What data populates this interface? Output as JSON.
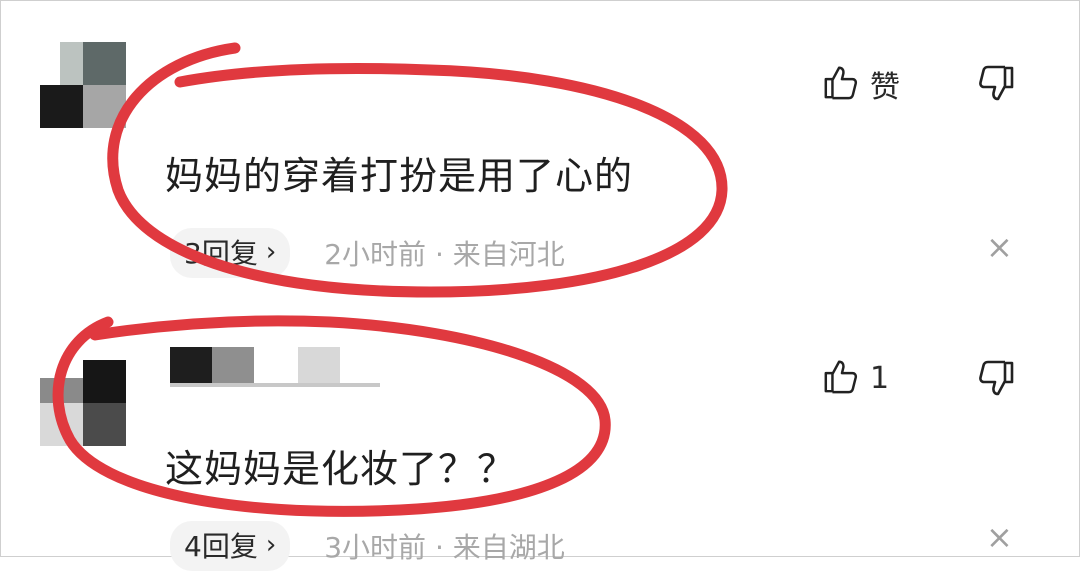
{
  "comments": [
    {
      "text": "妈妈的穿着打扮是用了心的",
      "replies_label": "3回复",
      "chevron": "›",
      "meta": "2小时前 · 来自河北",
      "like_label": "赞",
      "like_icon": "thumbs-up-icon",
      "dislike_icon": "thumbs-down-icon",
      "close_glyph": "×"
    },
    {
      "text": "这妈妈是化妆了？？",
      "replies_label": "4回复",
      "chevron": "›",
      "meta": "3小时前 · 来自湖北",
      "like_label": "1",
      "like_icon": "thumbs-up-icon",
      "dislike_icon": "thumbs-down-icon",
      "close_glyph": "×"
    }
  ],
  "colors": {
    "annotation": "#e0393f",
    "text": "#1f1f1f",
    "meta": "#a8a8a8",
    "pill": "#f3f3f3"
  }
}
